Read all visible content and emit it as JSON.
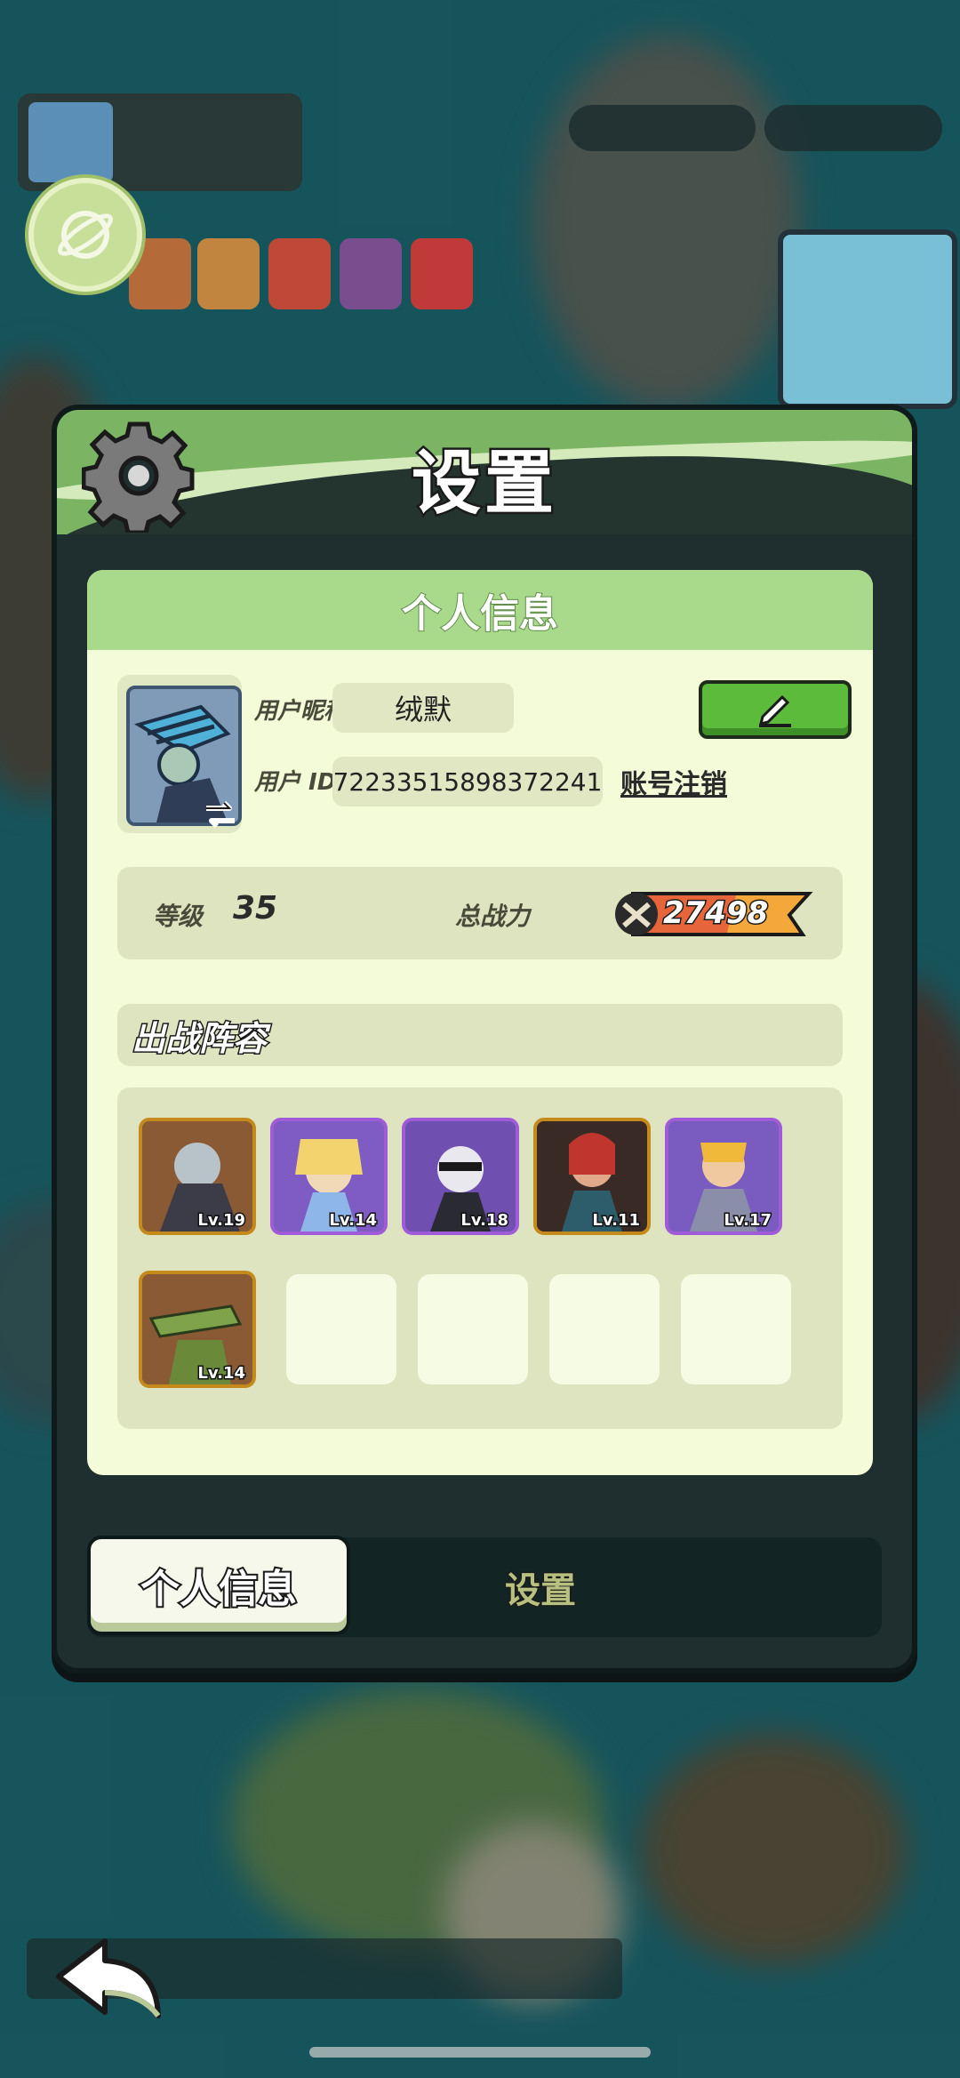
{
  "panel": {
    "title": "设置",
    "card_title": "个人信息"
  },
  "profile": {
    "nickname_label": "用户昵称",
    "nickname": "绒默",
    "id_label": "用户 ID",
    "user_id": "72233515898372241",
    "cancel_account": "账号注销"
  },
  "stats": {
    "level_label": "等级",
    "level": "35",
    "power_label": "总战力",
    "power": "27498"
  },
  "lineup": {
    "title": "出战阵容",
    "heroes": [
      {
        "level": "Lv.19",
        "rarity": "orange"
      },
      {
        "level": "Lv.14",
        "rarity": "purple"
      },
      {
        "level": "Lv.18",
        "rarity": "purple"
      },
      {
        "level": "Lv.11",
        "rarity": "orange"
      },
      {
        "level": "Lv.17",
        "rarity": "purple"
      },
      {
        "level": "Lv.14",
        "rarity": "orange"
      }
    ],
    "empty_slots": 4
  },
  "tabs": {
    "active": "个人信息",
    "inactive": "设置"
  },
  "colors": {
    "accent_green": "#7bb564",
    "card_bg": "#f4fbd9",
    "edit_button": "#5cbb3b",
    "power_badge": "#f5a83a"
  }
}
